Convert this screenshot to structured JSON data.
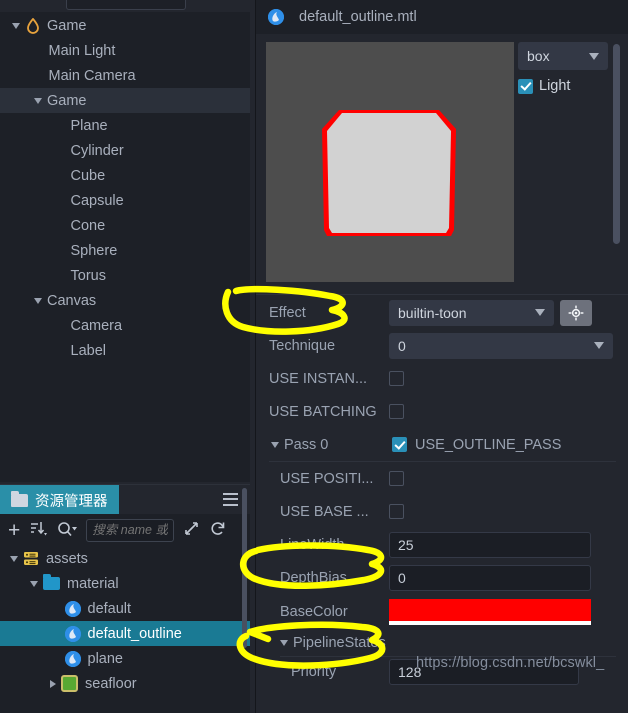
{
  "hierarchy": {
    "search_placeholder": "",
    "items": [
      {
        "label": "Game",
        "depth": 0,
        "caret": "down",
        "icon": "flame-icon",
        "selected": false
      },
      {
        "label": "Main Light",
        "depth": 1,
        "caret": "none",
        "icon": "none",
        "selected": false
      },
      {
        "label": "Main Camera",
        "depth": 1,
        "caret": "none",
        "icon": "none",
        "selected": false
      },
      {
        "label": "Game",
        "depth": 1,
        "caret": "down",
        "icon": "none",
        "selected": true
      },
      {
        "label": "Plane",
        "depth": 2,
        "caret": "none",
        "icon": "none",
        "selected": false
      },
      {
        "label": "Cylinder",
        "depth": 2,
        "caret": "none",
        "icon": "none",
        "selected": false
      },
      {
        "label": "Cube",
        "depth": 2,
        "caret": "none",
        "icon": "none",
        "selected": false
      },
      {
        "label": "Capsule",
        "depth": 2,
        "caret": "none",
        "icon": "none",
        "selected": false
      },
      {
        "label": "Cone",
        "depth": 2,
        "caret": "none",
        "icon": "none",
        "selected": false
      },
      {
        "label": "Sphere",
        "depth": 2,
        "caret": "none",
        "icon": "none",
        "selected": false
      },
      {
        "label": "Torus",
        "depth": 2,
        "caret": "none",
        "icon": "none",
        "selected": false
      },
      {
        "label": "Canvas",
        "depth": 1,
        "caret": "down",
        "icon": "none",
        "selected": false
      },
      {
        "label": "Camera",
        "depth": 2,
        "caret": "none",
        "icon": "none",
        "selected": false
      },
      {
        "label": "Label",
        "depth": 2,
        "caret": "none",
        "icon": "none",
        "selected": false
      }
    ]
  },
  "assets": {
    "tab_label": "资源管理器",
    "toolbar": {
      "add_label": "+",
      "sort_label": "sort-icon",
      "search_label": "search-icon",
      "collapse_label": "collapse-icon",
      "refresh_label": "refresh-icon",
      "search_placeholder": "搜索 name 或 "
    },
    "items": [
      {
        "label": "assets",
        "depth": 0,
        "caret": "down",
        "icon": "database-icon",
        "selected": false
      },
      {
        "label": "material",
        "depth": 1,
        "caret": "down",
        "icon": "folder-icon",
        "selected": false
      },
      {
        "label": "default",
        "depth": 2,
        "caret": "none",
        "icon": "material-icon",
        "selected": false
      },
      {
        "label": "default_outline",
        "depth": 2,
        "caret": "none",
        "icon": "material-icon",
        "selected": true
      },
      {
        "label": "plane",
        "depth": 2,
        "caret": "none",
        "icon": "material-icon",
        "selected": false
      },
      {
        "label": "seafloor",
        "depth": 2,
        "caret": "right",
        "icon": "texture-icon",
        "selected": false
      }
    ]
  },
  "inspector": {
    "title": "default_outline.mtl",
    "preview": {
      "shape_select": "box",
      "light_label": "Light",
      "light_checked": true
    },
    "properties": {
      "effect_label": "Effect",
      "effect_value": "builtin-toon",
      "technique_label": "Technique",
      "technique_value": "0",
      "use_instancing_label": "USE INSTAN...",
      "use_instancing_checked": false,
      "use_batching_label": "USE BATCHING",
      "use_batching_checked": false,
      "pass0_label": "Pass 0",
      "use_outline_pass_label": "USE_OUTLINE_PASS",
      "use_outline_pass_checked": true,
      "use_position_label": "USE POSITI...",
      "use_position_checked": false,
      "use_base_label": "USE BASE ...",
      "use_base_checked": false,
      "linewidth_label": "LineWidth",
      "linewidth_value": "25",
      "depthbias_label": "DepthBias",
      "depthbias_value": "0",
      "basecolor_label": "BaseColor",
      "basecolor_value": "#FF0000",
      "pipelinestates_label": "PipelineStates",
      "priority_label": "Priority",
      "priority_value": "128"
    }
  },
  "watermark": "https://blog.csdn.net/bcswkl_",
  "colors": {
    "accent": "#2a8fa8",
    "selection": "#1a7a94",
    "annotation": "#ffff00",
    "outline_red": "#ff0000",
    "panel_bg": "#1d2027",
    "app_bg": "#23262e"
  }
}
